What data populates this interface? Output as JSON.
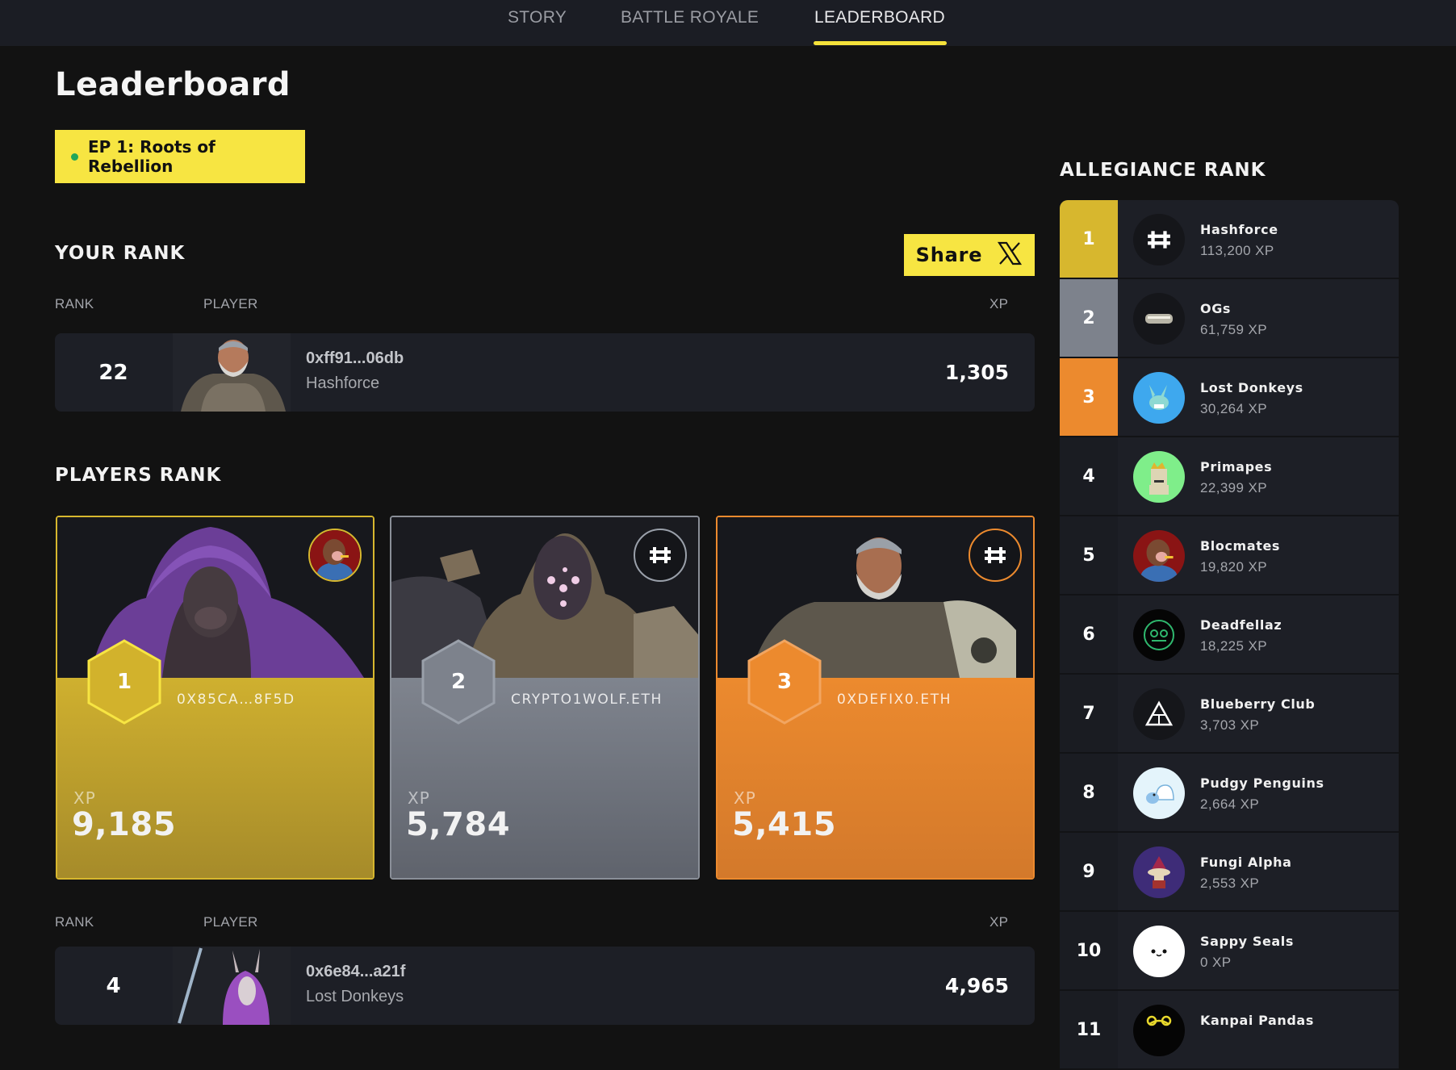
{
  "nav": {
    "tabs": [
      {
        "label": "STORY",
        "active": false
      },
      {
        "label": "BATTLE ROYALE",
        "active": false
      },
      {
        "label": "LEADERBOARD",
        "active": true
      }
    ]
  },
  "header": {
    "title": "Leaderboard",
    "episode": "EP 1: Roots of Rebellion"
  },
  "colors": {
    "accent": "#f7e542",
    "gold": "#d7b72e",
    "silver": "#7d828c",
    "bronze": "#ec8a2e",
    "background": "#121212",
    "row": "#1d1f26"
  },
  "your_rank": {
    "title": "YOUR RANK",
    "share_label": "Share",
    "share_icon": "x-logo-icon",
    "columns": {
      "rank": "RANK",
      "player": "PLAYER",
      "xp": "XP"
    },
    "row": {
      "rank": "22",
      "player": "0xff91...06db",
      "team": "Hashforce",
      "xp": "1,305"
    }
  },
  "players_rank": {
    "title": "PLAYERS RANK",
    "podium": [
      {
        "rank": "1",
        "name": "0X85CA…8F5D",
        "xp_label": "XP",
        "xp": "9,185",
        "team_icon": "blocmates-avatar-icon"
      },
      {
        "rank": "2",
        "name": "CRYPTO1WOLF.ETH",
        "xp_label": "XP",
        "xp": "5,784",
        "team_icon": "hashforce-icon"
      },
      {
        "rank": "3",
        "name": "0XDEFIX0.ETH",
        "xp_label": "XP",
        "xp": "5,415",
        "team_icon": "hashforce-icon"
      }
    ],
    "columns": {
      "rank": "RANK",
      "player": "PLAYER",
      "xp": "XP"
    },
    "rows": [
      {
        "rank": "4",
        "player": "0x6e84...a21f",
        "team": "Lost Donkeys",
        "xp": "4,965"
      }
    ]
  },
  "allegiance": {
    "title": "ALLEGIANCE RANK",
    "items": [
      {
        "rank": "1",
        "name": "Hashforce",
        "xp": "113,200 XP",
        "icon": "hashforce-icon"
      },
      {
        "rank": "2",
        "name": "OGs",
        "xp": "61,759 XP",
        "icon": "ogs-icon"
      },
      {
        "rank": "3",
        "name": "Lost Donkeys",
        "xp": "30,264 XP",
        "icon": "lost-donkeys-icon"
      },
      {
        "rank": "4",
        "name": "Primapes",
        "xp": "22,399 XP",
        "icon": "primapes-icon"
      },
      {
        "rank": "5",
        "name": "Blocmates",
        "xp": "19,820 XP",
        "icon": "blocmates-icon"
      },
      {
        "rank": "6",
        "name": "Deadfellaz",
        "xp": "18,225 XP",
        "icon": "deadfellaz-icon"
      },
      {
        "rank": "7",
        "name": "Blueberry Club",
        "xp": "3,703 XP",
        "icon": "blueberry-club-icon"
      },
      {
        "rank": "8",
        "name": "Pudgy Penguins",
        "xp": "2,664 XP",
        "icon": "pudgy-penguins-icon"
      },
      {
        "rank": "9",
        "name": "Fungi Alpha",
        "xp": "2,553 XP",
        "icon": "fungi-alpha-icon"
      },
      {
        "rank": "10",
        "name": "Sappy Seals",
        "xp": "0 XP",
        "icon": "sappy-seals-icon"
      },
      {
        "rank": "11",
        "name": "Kanpai Pandas",
        "xp": "",
        "icon": "kanpai-pandas-icon"
      }
    ]
  }
}
